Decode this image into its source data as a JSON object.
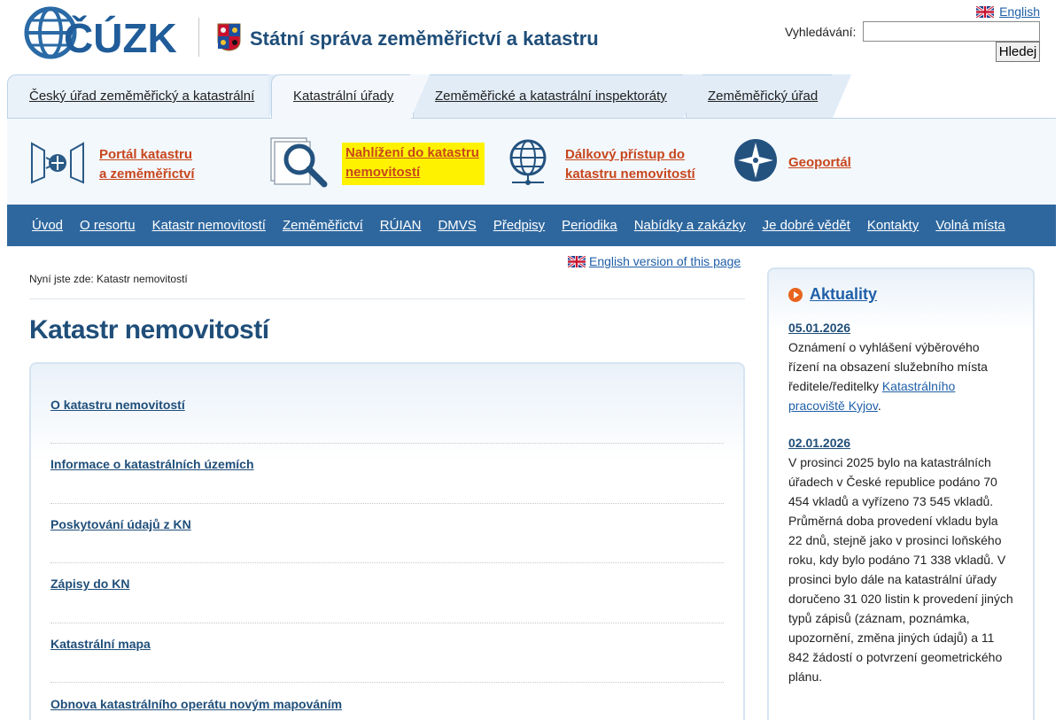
{
  "header": {
    "logo_text": "ČÚZK",
    "site_title": "Státní správa zeměměřictví a katastru",
    "lang_link": "English",
    "search_label": "Vyhledávání:",
    "search_value": "",
    "search_button": "Hledej"
  },
  "tabs": [
    {
      "label": "Český úřad zeměměřický a katastrální"
    },
    {
      "label": "Katastrální úřady"
    },
    {
      "label": "Zeměměřické a katastrální inspektoráty"
    },
    {
      "label": "Zeměměřický úřad"
    }
  ],
  "portals": [
    {
      "line1": "Portál katastru",
      "line2": "a zeměměřictví",
      "icon": "cadastre-portal-icon"
    },
    {
      "line1": "Nahlížení do katastru",
      "line2": "nemovitostí",
      "icon": "magnifier-icon",
      "highlighted": true
    },
    {
      "line1": "Dálkový přístup do",
      "line2": "katastru nemovitostí",
      "icon": "globe-icon"
    },
    {
      "line1": "Geoportál",
      "line2": "",
      "icon": "compass-icon"
    }
  ],
  "main_nav": [
    {
      "label": "Úvod"
    },
    {
      "label": "O resortu"
    },
    {
      "label": "Katastr nemovitostí"
    },
    {
      "label": "Zeměměřictví"
    },
    {
      "label": "RÚIAN"
    },
    {
      "label": "DMVS"
    },
    {
      "label": "Předpisy"
    },
    {
      "label": "Periodika"
    },
    {
      "label": "Nabídky a zakázky"
    },
    {
      "label": "Je dobré vědět"
    },
    {
      "label": "Kontakty"
    },
    {
      "label": "Volná místa"
    }
  ],
  "content": {
    "english_version": "English version of this page",
    "breadcrumb": "Nyní jste zde: Katastr nemovitostí",
    "page_title": "Katastr nemovitostí",
    "links": [
      {
        "label": "O katastru nemovitostí"
      },
      {
        "label": "Informace o katastrálních územích"
      },
      {
        "label": "Poskytování údajů z KN"
      },
      {
        "label": "Zápisy do KN"
      },
      {
        "label": "Katastrální mapa"
      },
      {
        "label": "Obnova katastrálního operátu novým mapováním"
      }
    ]
  },
  "sidebar": {
    "heading": "Aktuality",
    "news": [
      {
        "date": "05.01.2026",
        "text": "Oznámení o vyhlášení výběrového řízení na obsazení služebního místa ředitele/ředitelky ",
        "link": "Katastrálního pracoviště Kyjov",
        "suffix": "."
      },
      {
        "date": "02.01.2026",
        "text": "V prosinci 2025 bylo na katastrálních úřadech v České republice podáno 70 454 vkladů a vyřízeno 73 545 vkladů. Průměrná doba provedení vkladu byla 22 dnů, stejně jako v prosinci loňského roku, kdy bylo podáno 71 338 vkladů. V prosinci bylo dále na katastrální úřady doručeno 31 020 listin k provedení jiných typů zápisů (záznam, poznámka, upozornění, změna jiných údajů) a 11 842 žádostí o potvrzení geometrického plánu."
      }
    ]
  },
  "colors": {
    "brand_blue": "#1f4e79",
    "nav_blue": "#2e679e",
    "portal_orange": "#c8461d",
    "highlight": "#fff200",
    "bullet_orange": "#e8641e"
  }
}
